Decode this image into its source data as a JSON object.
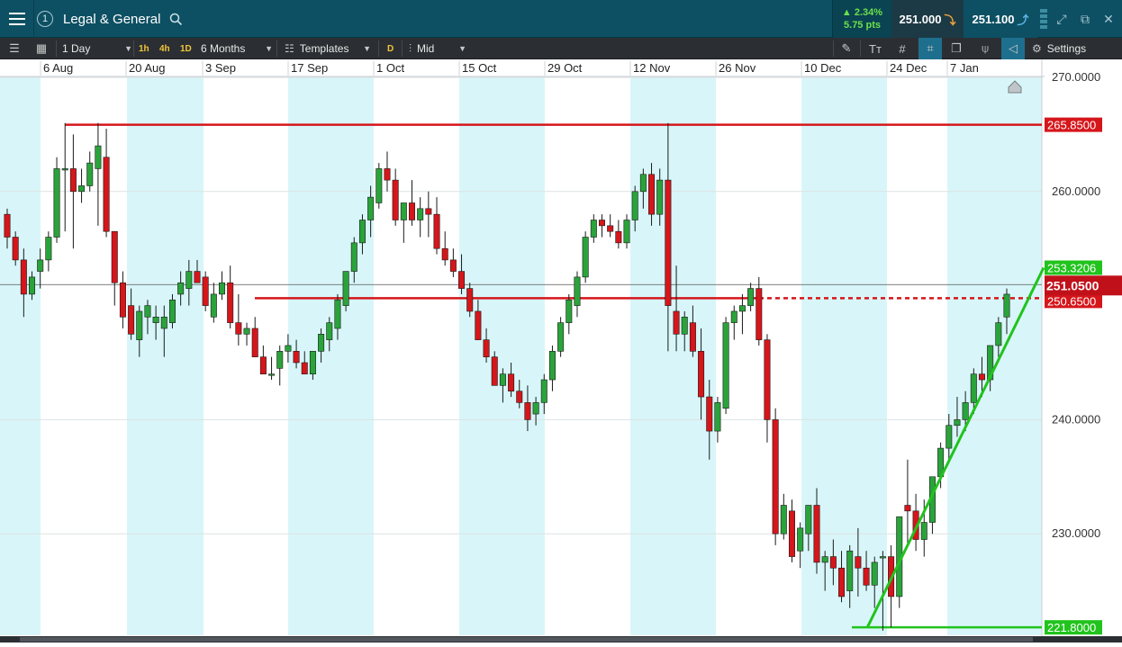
{
  "header": {
    "badge": "1",
    "instrument": "Legal & General",
    "change_pct": "▲ 2.34%",
    "change_pts": "5.75 pts",
    "sell_price": "251.000",
    "buy_price": "251.100",
    "icons": [
      "menu-icon",
      "info-icon",
      "search-icon",
      "signal-icon",
      "expand-icon",
      "popout-icon",
      "close-icon"
    ]
  },
  "toolbar": {
    "interval": "1 Day",
    "tf_1h": "1h",
    "tf_4h": "4h",
    "tf_1d": "1D",
    "range": "6 Months",
    "templates": "Templates",
    "d_label": "D",
    "price_type": "Mid",
    "settings": "Settings"
  },
  "colors": {
    "up": "#2aa33b",
    "down": "#d5161b",
    "band": "#d8f6f9",
    "level_red": "#d5161b",
    "level_green": "#21c31d",
    "header_bg": "#0d5063",
    "toolbar_bg": "#2b2f33"
  },
  "chart_data": {
    "type": "candlestick",
    "x_tick_labels": [
      "6 Aug",
      "20 Aug",
      "3 Sep",
      "17 Sep",
      "1 Oct",
      "15 Oct",
      "29 Oct",
      "12 Nov",
      "26 Nov",
      "10 Dec",
      "24 Dec",
      "7 Jan"
    ],
    "y_tick_labels": [
      "270.0000",
      "260.0000",
      "240.0000",
      "230.0000"
    ],
    "ylim": [
      221,
      271
    ],
    "y_ticks": [
      270,
      260,
      240,
      230
    ],
    "candles": [
      [
        258.0,
        258.5,
        255.0,
        256.0
      ],
      [
        256.0,
        256.5,
        253.5,
        254.0
      ],
      [
        254.0,
        255.0,
        249.0,
        251.0
      ],
      [
        251.0,
        253.0,
        250.5,
        252.5
      ],
      [
        253.0,
        255.0,
        251.5,
        254.0
      ],
      [
        254.0,
        256.5,
        253.0,
        256.0
      ],
      [
        256.0,
        263.0,
        255.5,
        262.0
      ],
      [
        262.0,
        266.0,
        256.5,
        262.0
      ],
      [
        262.0,
        265.0,
        255.0,
        260.0
      ],
      [
        260.0,
        262.0,
        259.0,
        260.5
      ],
      [
        260.5,
        263.5,
        260.0,
        262.5
      ],
      [
        262.0,
        266.0,
        257.0,
        264.0
      ],
      [
        263.0,
        265.5,
        256.0,
        256.5
      ],
      [
        256.5,
        256.5,
        250.0,
        252.0
      ],
      [
        252.0,
        253.0,
        248.0,
        249.0
      ],
      [
        250.0,
        251.5,
        247.0,
        247.5
      ],
      [
        247.0,
        250.0,
        245.5,
        249.5
      ],
      [
        249.0,
        250.5,
        247.5,
        250.0
      ],
      [
        248.5,
        250.0,
        247.0,
        249.0
      ],
      [
        248.0,
        250.0,
        245.5,
        249.0
      ],
      [
        248.5,
        251.0,
        248.0,
        250.5
      ],
      [
        251.0,
        253.0,
        250.0,
        252.0
      ],
      [
        251.5,
        254.0,
        250.0,
        253.0
      ],
      [
        253.0,
        254.0,
        252.5,
        252.0
      ],
      [
        252.5,
        253.0,
        249.5,
        250.0
      ],
      [
        249.0,
        252.0,
        248.5,
        251.0
      ],
      [
        251.0,
        253.0,
        250.5,
        252.0
      ],
      [
        252.0,
        253.5,
        248.0,
        248.5
      ],
      [
        248.5,
        251.0,
        246.5,
        247.5
      ],
      [
        247.5,
        248.5,
        246.5,
        248.0
      ],
      [
        248.0,
        249.0,
        245.5,
        245.5
      ],
      [
        245.5,
        246.5,
        244.0,
        244.0
      ],
      [
        244.0,
        245.5,
        243.5,
        244.0
      ],
      [
        244.5,
        246.5,
        243.0,
        246.0
      ],
      [
        246.0,
        247.5,
        245.0,
        246.5
      ],
      [
        246.0,
        247.0,
        244.5,
        245.0
      ],
      [
        245.0,
        246.0,
        244.0,
        244.0
      ],
      [
        244.0,
        246.0,
        243.5,
        246.0
      ],
      [
        246.0,
        248.0,
        245.0,
        247.5
      ],
      [
        247.0,
        249.0,
        246.0,
        248.5
      ],
      [
        248.0,
        251.0,
        247.0,
        250.5
      ],
      [
        250.0,
        253.0,
        249.5,
        253.0
      ],
      [
        253.0,
        256.0,
        252.0,
        255.5
      ],
      [
        255.5,
        258.0,
        254.5,
        257.5
      ],
      [
        257.5,
        260.5,
        256.0,
        259.5
      ],
      [
        259.0,
        262.5,
        258.5,
        262.0
      ],
      [
        262.0,
        263.5,
        260.0,
        261.0
      ],
      [
        261.0,
        262.0,
        257.0,
        257.5
      ],
      [
        257.5,
        259.0,
        255.5,
        259.0
      ],
      [
        259.0,
        261.0,
        257.0,
        257.5
      ],
      [
        257.5,
        259.5,
        256.0,
        258.5
      ],
      [
        258.5,
        260.0,
        256.0,
        258.0
      ],
      [
        258.0,
        259.5,
        254.5,
        255.0
      ],
      [
        255.0,
        256.5,
        253.5,
        254.0
      ],
      [
        254.0,
        255.0,
        252.5,
        253.0
      ],
      [
        253.0,
        254.5,
        251.0,
        251.5
      ],
      [
        251.5,
        252.0,
        249.0,
        249.5
      ],
      [
        249.5,
        250.5,
        247.0,
        247.0
      ],
      [
        247.0,
        248.0,
        245.0,
        245.5
      ],
      [
        245.5,
        246.0,
        243.0,
        243.0
      ],
      [
        243.0,
        244.5,
        241.5,
        244.0
      ],
      [
        244.0,
        245.0,
        242.0,
        242.5
      ],
      [
        242.5,
        243.5,
        241.0,
        241.5
      ],
      [
        241.5,
        243.0,
        239.0,
        240.0
      ],
      [
        240.5,
        242.0,
        239.5,
        241.5
      ],
      [
        241.5,
        244.0,
        240.5,
        243.5
      ],
      [
        243.5,
        246.5,
        242.5,
        246.0
      ],
      [
        246.0,
        249.0,
        245.5,
        248.5
      ],
      [
        248.5,
        251.0,
        247.5,
        250.5
      ],
      [
        250.0,
        253.0,
        249.0,
        252.5
      ],
      [
        252.5,
        256.5,
        252.0,
        256.0
      ],
      [
        256.0,
        258.0,
        255.5,
        257.5
      ],
      [
        257.5,
        258.0,
        256.0,
        257.0
      ],
      [
        257.0,
        258.0,
        256.0,
        256.5
      ],
      [
        256.5,
        257.5,
        255.0,
        255.5
      ],
      [
        255.5,
        258.0,
        255.0,
        257.5
      ],
      [
        257.5,
        260.5,
        256.5,
        260.0
      ],
      [
        260.0,
        262.0,
        258.5,
        261.5
      ],
      [
        261.5,
        262.5,
        257.0,
        258.0
      ],
      [
        258.0,
        262.0,
        257.0,
        261.0
      ],
      [
        261.0,
        266.0,
        246.0,
        250.0
      ],
      [
        249.5,
        253.5,
        246.0,
        247.5
      ],
      [
        247.5,
        249.5,
        246.0,
        249.0
      ],
      [
        248.5,
        250.0,
        245.5,
        246.0
      ],
      [
        246.0,
        248.0,
        240.0,
        242.0
      ],
      [
        242.0,
        243.5,
        236.5,
        239.0
      ],
      [
        239.0,
        242.0,
        238.0,
        241.5
      ],
      [
        241.0,
        249.0,
        240.5,
        248.5
      ],
      [
        248.5,
        250.0,
        247.0,
        249.5
      ],
      [
        249.5,
        251.0,
        247.5,
        250.0
      ],
      [
        250.0,
        252.0,
        249.5,
        251.5
      ],
      [
        251.5,
        252.5,
        246.5,
        247.0
      ],
      [
        247.0,
        247.5,
        238.0,
        240.0
      ],
      [
        240.0,
        241.0,
        229.0,
        230.0
      ],
      [
        230.0,
        233.5,
        229.5,
        232.5
      ],
      [
        232.0,
        233.0,
        227.5,
        228.0
      ],
      [
        228.5,
        231.0,
        227.0,
        230.5
      ],
      [
        230.0,
        232.5,
        228.5,
        232.5
      ],
      [
        232.5,
        234.0,
        226.5,
        227.5
      ],
      [
        227.5,
        228.5,
        225.0,
        228.0
      ],
      [
        228.0,
        229.5,
        225.5,
        227.0
      ],
      [
        227.0,
        228.5,
        224.0,
        224.5
      ],
      [
        225.0,
        229.0,
        223.5,
        228.5
      ],
      [
        228.0,
        230.5,
        224.5,
        227.0
      ],
      [
        227.0,
        228.5,
        225.0,
        225.5
      ],
      [
        225.5,
        228.0,
        223.5,
        227.5
      ],
      [
        228.0,
        228.5,
        221.5,
        228.0
      ],
      [
        228.0,
        229.0,
        221.8,
        224.5
      ],
      [
        224.5,
        230.0,
        223.5,
        231.5
      ],
      [
        232.5,
        236.5,
        229.0,
        232.0
      ],
      [
        232.0,
        233.5,
        228.5,
        229.5
      ],
      [
        229.5,
        233.0,
        228.0,
        231.0
      ],
      [
        231.0,
        235.0,
        230.0,
        235.0
      ],
      [
        235.0,
        238.0,
        234.0,
        237.5
      ],
      [
        237.5,
        240.5,
        236.5,
        239.5
      ],
      [
        239.5,
        242.0,
        238.5,
        240.0
      ],
      [
        240.0,
        242.5,
        239.0,
        241.5
      ],
      [
        241.5,
        244.5,
        240.5,
        244.0
      ],
      [
        244.0,
        245.5,
        242.0,
        243.5
      ],
      [
        243.5,
        246.5,
        242.5,
        246.5
      ],
      [
        246.5,
        249.0,
        245.5,
        248.5
      ],
      [
        249.0,
        251.5,
        247.5,
        251.0
      ]
    ],
    "levels": [
      {
        "name": "resistance",
        "value": 265.85,
        "label": "265.8500"
      },
      {
        "name": "support-mid",
        "value": 250.65,
        "label": "250.6500"
      },
      {
        "name": "low",
        "value": 221.8,
        "label": "221.8000"
      },
      {
        "name": "trendline-end",
        "value": 253.3206,
        "label": "253.3206"
      },
      {
        "name": "current-price",
        "value": 251.05,
        "label": "251.0500"
      }
    ],
    "trendline": {
      "from": [
        105,
        221.8
      ],
      "to": [
        122,
        253.3206
      ]
    },
    "grid": true
  }
}
